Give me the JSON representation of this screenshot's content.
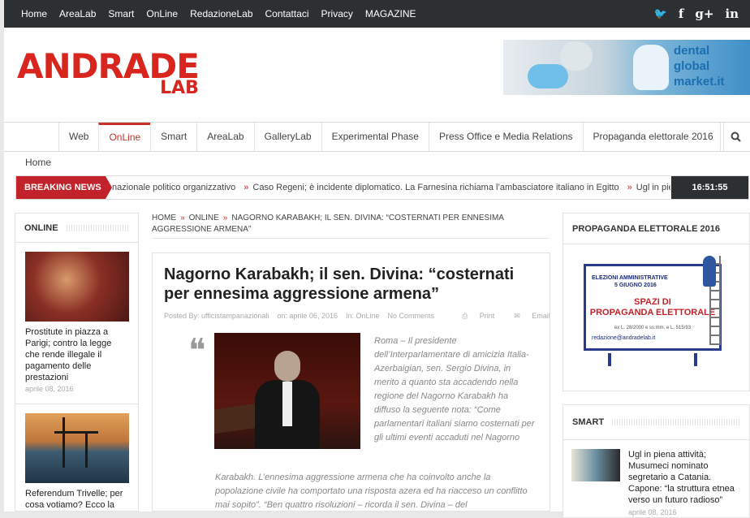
{
  "topbar": {
    "menu": [
      "Home",
      "AreaLab",
      "Smart",
      "OnLine",
      "RedazioneLab",
      "Contattaci",
      "Privacy",
      "MAGAZINE"
    ],
    "social": [
      "twitter-icon",
      "facebook-icon",
      "googleplus-icon",
      "linkedin-icon"
    ],
    "social_glyphs": [
      "🐦",
      "f",
      "g+",
      "in"
    ]
  },
  "logo": {
    "line1": "ANDRADE",
    "line2": "LAB"
  },
  "banner": {
    "text_lines": [
      "dental",
      "global",
      "market.it"
    ]
  },
  "nav": {
    "items": [
      "Web",
      "OnLine",
      "Smart",
      "AreaLab",
      "GalleryLab",
      "Experimental Phase",
      "Press Office e Media Relations",
      "Propaganda elettorale 2016"
    ],
    "active": "OnLine"
  },
  "breadcrumb_home": "Home",
  "ticker": {
    "label": "BREAKING NEWS",
    "items": [
      "nazionale politico organizzativo",
      "Caso Regeni; è incidente diplomatico. La Farnesina richiama l’ambasciatore italiano in Egitto",
      "Ugl in piena a"
    ],
    "time": "16:51:55"
  },
  "left_widget": {
    "title": "ONLINE",
    "posts": [
      {
        "title": "Prostitute in piazza a Parigi; contro la legge che rende illegale il pagamento delle prestazioni",
        "date": "aprile 08, 2016"
      },
      {
        "title": "Referendum Trivelle; per cosa votiamo? Ecco la",
        "date": ""
      }
    ]
  },
  "crumbs": {
    "items": [
      "HOME",
      "ONLINE",
      "NAGORNO KARABAKH; IL SEN. DIVINA: “COSTERNATI PER ENNESIMA AGGRESSIONE ARMENA”"
    ]
  },
  "article": {
    "title": "Nagorno Karabakh; il sen. Divina: “costernati per ennesima aggressione armena”",
    "meta": {
      "author": "Posted By: ufficistampanazionali",
      "date": "on: aprile 06, 2016",
      "category": "In: OnLine",
      "comments": "No Comments",
      "print": "Print",
      "email": "Email"
    },
    "quote_mark": "❝",
    "body_side": "Roma – Il presidente dell’Interparlamentare di amicizia Italia-Azerbaigian, sen. Sergio Divina, in merito a quanto sta accadendo nella regione del Nagorno Karabakh ha diffuso la seguente nota: “Come parlamentari italiani siamo costernati per gli ultimi eventi accaduti nel Nagorno",
    "body_full": "Karabakh. L’ennesima aggressione armena che ha coinvolto anche la popolazione civile ha comportato una risposta azera ed ha riacceso un conflitto mai sopito”. “Ben quattro risoluzioni – ricorda il sen. Divina –  del"
  },
  "right": {
    "widget1_title": "PROPAGANDA ELETTORALE 2016",
    "billboard": {
      "line1": "ELEZIONI AMMINISTRATIVE",
      "line2": "5 GIUGNO 2016",
      "main1": "SPAZI DI",
      "main2": "PROPAGANDA ELETTORALE",
      "law": "ex L. 28/2000 e ss.mm. e L. 515/93",
      "email": "redazione@andradelab.it"
    },
    "widget2_title": "SMART",
    "smart_post": {
      "title": "Ugl in piena attività; Musumeci nominato segretario a Catania. Capone: “la struttura etnea verso un futuro radioso”",
      "date": "aprile 08, 2016"
    }
  }
}
